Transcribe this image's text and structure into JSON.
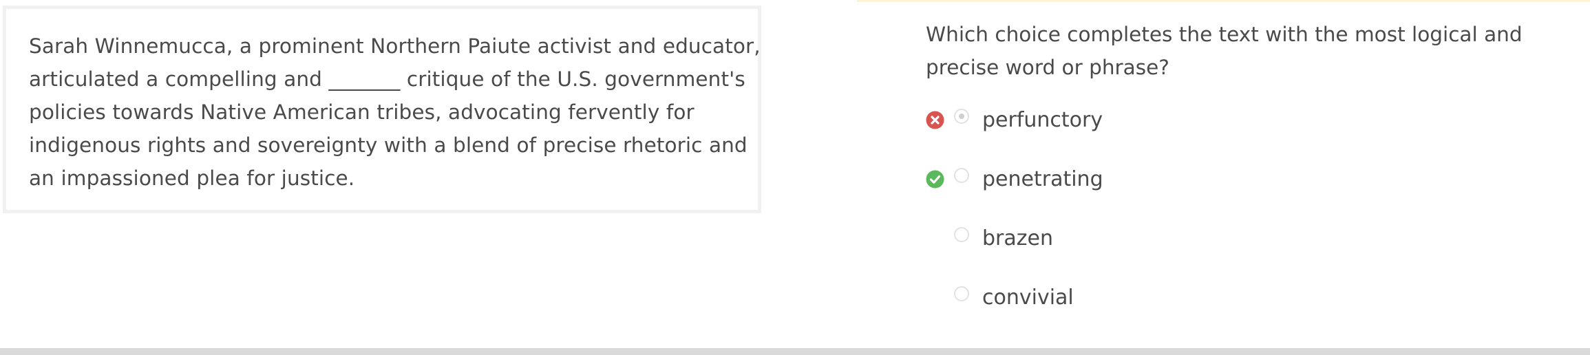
{
  "passage": {
    "lines": [
      "Sarah Winnemucca, a prominent Northern Paiute activist and educator,",
      "articulated a compelling and _______ critique of the U.S. government's",
      "policies towards Native American tribes, advocating fervently for",
      "indigenous rights and sovereignty with a blend of precise rhetoric and",
      "an impassioned plea for justice."
    ]
  },
  "question": {
    "lines": [
      "Which choice completes the text with the most logical and",
      "precise word or phrase?"
    ]
  },
  "choices": [
    {
      "label": "perfunctory",
      "selected": true,
      "status": "incorrect",
      "status_icon": "x-circle-icon"
    },
    {
      "label": "penetrating",
      "selected": false,
      "status": "correct",
      "status_icon": "check-circle-icon"
    },
    {
      "label": "brazen",
      "selected": false,
      "status": "none"
    },
    {
      "label": "convivial",
      "selected": false,
      "status": "none"
    }
  ],
  "colors": {
    "incorrect": "#d9534f",
    "correct": "#5cb85c",
    "text": "#4a4a4a",
    "card_border": "#f1f1f1",
    "accent_bar": "#fdf4d6",
    "bottom_bar": "#d9d9d9"
  }
}
